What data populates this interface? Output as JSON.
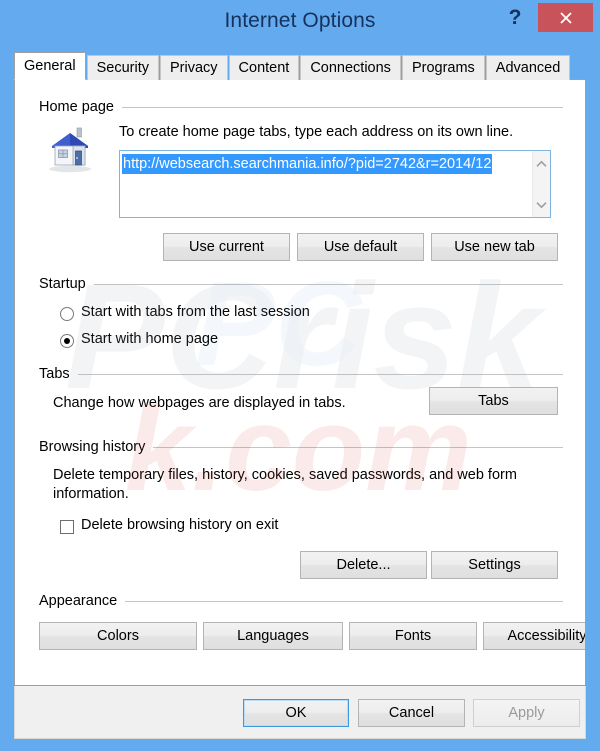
{
  "window": {
    "title": "Internet Options",
    "help_label": "?",
    "close_label": "×",
    "frame_color": "#63aaee",
    "close_color": "#c8535a",
    "title_color": "#16325c"
  },
  "tabs": [
    {
      "label": "General",
      "active": true
    },
    {
      "label": "Security",
      "active": false
    },
    {
      "label": "Privacy",
      "active": false
    },
    {
      "label": "Content",
      "active": false
    },
    {
      "label": "Connections",
      "active": false
    },
    {
      "label": "Programs",
      "active": false
    },
    {
      "label": "Advanced",
      "active": false
    }
  ],
  "home_page": {
    "group_label": "Home page",
    "description": "To create home page tabs, type each address on its own line.",
    "url_value": "http://websearch.searchmania.info/?pid=2742&r=2014/12",
    "url_selected": true,
    "selection_color": "#3399ff",
    "icon": "house-icon",
    "scroll_up_icon": "chevron-up-icon",
    "scroll_down_icon": "chevron-down-icon",
    "buttons": [
      {
        "label": "Use current"
      },
      {
        "label": "Use default"
      },
      {
        "label": "Use new tab"
      }
    ]
  },
  "startup": {
    "group_label": "Startup",
    "options": [
      {
        "label": "Start with tabs from the last session",
        "selected": false
      },
      {
        "label": "Start with home page",
        "selected": true
      }
    ]
  },
  "tabs_section": {
    "group_label": "Tabs",
    "description": "Change how webpages are displayed in tabs.",
    "button_label": "Tabs"
  },
  "browsing_history": {
    "group_label": "Browsing history",
    "description": "Delete temporary files, history, cookies, saved passwords, and web form information.",
    "checkbox_label": "Delete browsing history on exit",
    "checkbox_checked": false,
    "buttons": [
      {
        "label": "Delete..."
      },
      {
        "label": "Settings"
      }
    ]
  },
  "appearance": {
    "group_label": "Appearance",
    "buttons": [
      {
        "label": "Colors"
      },
      {
        "label": "Languages"
      },
      {
        "label": "Fonts"
      },
      {
        "label": "Accessibility"
      }
    ]
  },
  "footer": {
    "ok_label": "OK",
    "cancel_label": "Cancel",
    "apply_label": "Apply",
    "apply_disabled": true
  },
  "watermark": {
    "text": "PCrisk.com"
  }
}
